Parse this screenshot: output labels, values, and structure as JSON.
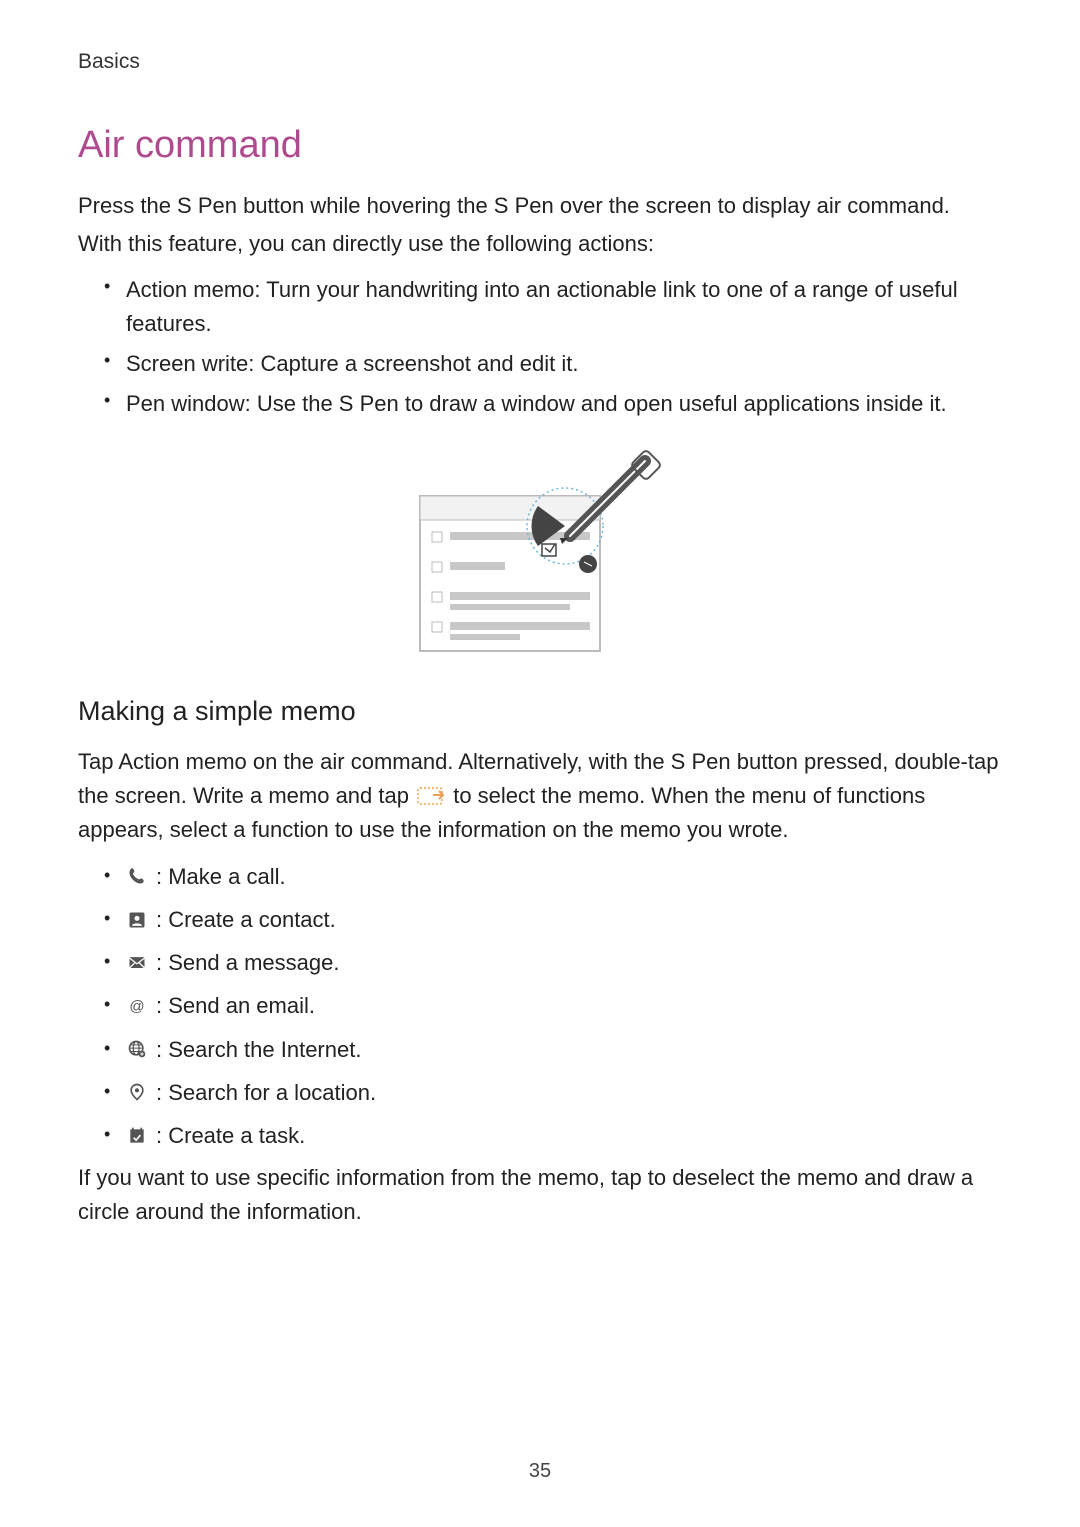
{
  "header": "Basics",
  "section_title": "Air command",
  "intro_p1": "Press the S Pen button while hovering the S Pen over the screen to display air command.",
  "intro_p2": "With this feature, you can directly use the following actions:",
  "feature_list": [
    {
      "label": "Action memo:",
      "desc": " Turn your handwriting into an actionable link to one of a range of useful features."
    },
    {
      "label": "Screen write:",
      "desc": " Capture a screenshot and edit it."
    },
    {
      "label": "Pen window:",
      "desc": " Use the S Pen to draw a window and open useful applications inside it."
    }
  ],
  "sub_heading": "Making a simple memo",
  "memo_intro_a": "Tap ",
  "memo_intro_bold": "Action memo",
  "memo_intro_b": " on the air command. Alternatively, with the S Pen button pressed, double-tap the screen. Write a memo and tap ",
  "memo_intro_c": " to select the memo. When the menu of functions appears, select a function to use the information on the memo you wrote.",
  "icon_actions": [
    {
      "icon": "phone-icon",
      "text": " : Make a call."
    },
    {
      "icon": "contact-icon",
      "text": " : Create a contact."
    },
    {
      "icon": "message-icon",
      "text": " : Send a message."
    },
    {
      "icon": "email-icon",
      "text": " : Send an email."
    },
    {
      "icon": "globe-icon",
      "text": " : Search the Internet."
    },
    {
      "icon": "location-icon",
      "text": " : Search for a location."
    },
    {
      "icon": "task-icon",
      "text": " : Create a task."
    }
  ],
  "closing_text": "If you want to use specific information from the memo, tap to deselect the memo and draw a circle around the information.",
  "page_number": "35"
}
